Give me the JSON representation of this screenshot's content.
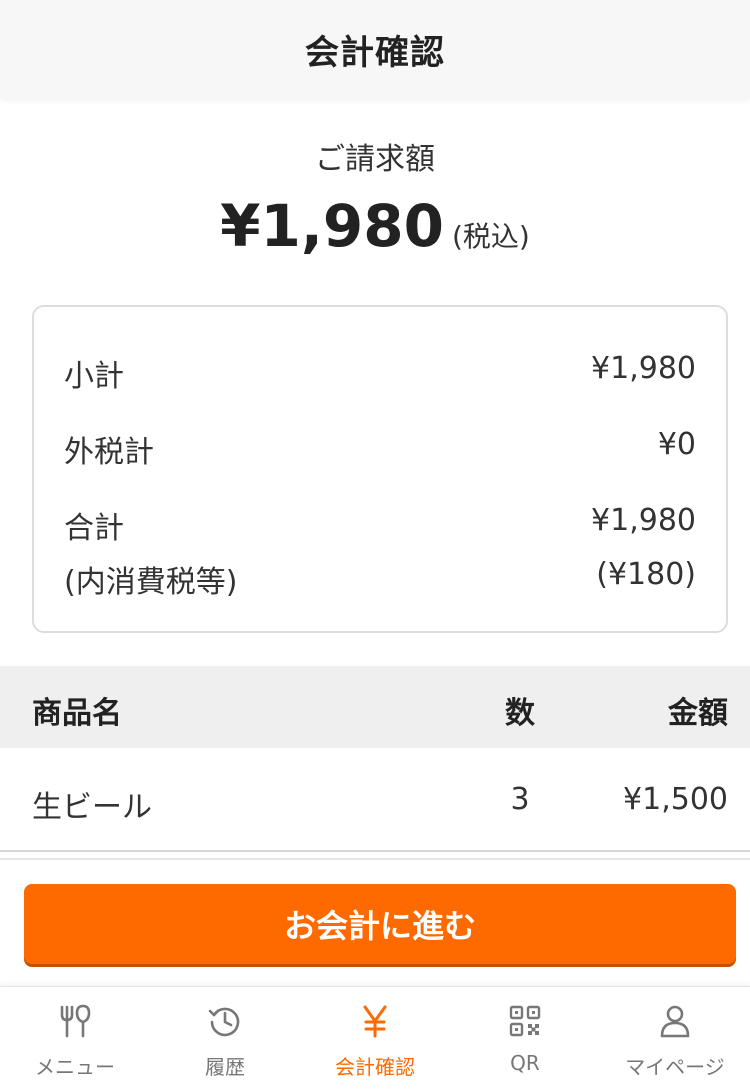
{
  "header": {
    "title": "会計確認"
  },
  "billing": {
    "label": "ご請求額",
    "amount": "¥1,980",
    "tax_note": "(税込)"
  },
  "summary": {
    "subtotal_label": "小計",
    "subtotal_value": "¥1,980",
    "external_tax_label": "外税計",
    "external_tax_value": "¥0",
    "total_label": "合計",
    "total_value": "¥1,980",
    "internal_tax_label": "(内消費税等)",
    "internal_tax_value": "(¥180)"
  },
  "table": {
    "headers": {
      "name": "商品名",
      "qty": "数",
      "price": "金額"
    },
    "rows": [
      {
        "name": "生ビール",
        "qty": "3",
        "price": "¥1,500"
      }
    ]
  },
  "checkout_button": {
    "label": "お会計に進む"
  },
  "nav": {
    "items": [
      {
        "label": "メニュー",
        "icon": "cutlery-icon"
      },
      {
        "label": "履歴",
        "icon": "history-icon"
      },
      {
        "label": "会計確認",
        "icon": "yen-icon",
        "active": true
      },
      {
        "label": "QR",
        "icon": "qr-code-icon"
      },
      {
        "label": "マイページ",
        "icon": "user-icon"
      }
    ]
  },
  "colors": {
    "accent": "#ff6a00",
    "inactive": "#777777",
    "header_bg": "#f7f7f7",
    "table_header_bg": "#efefef"
  }
}
